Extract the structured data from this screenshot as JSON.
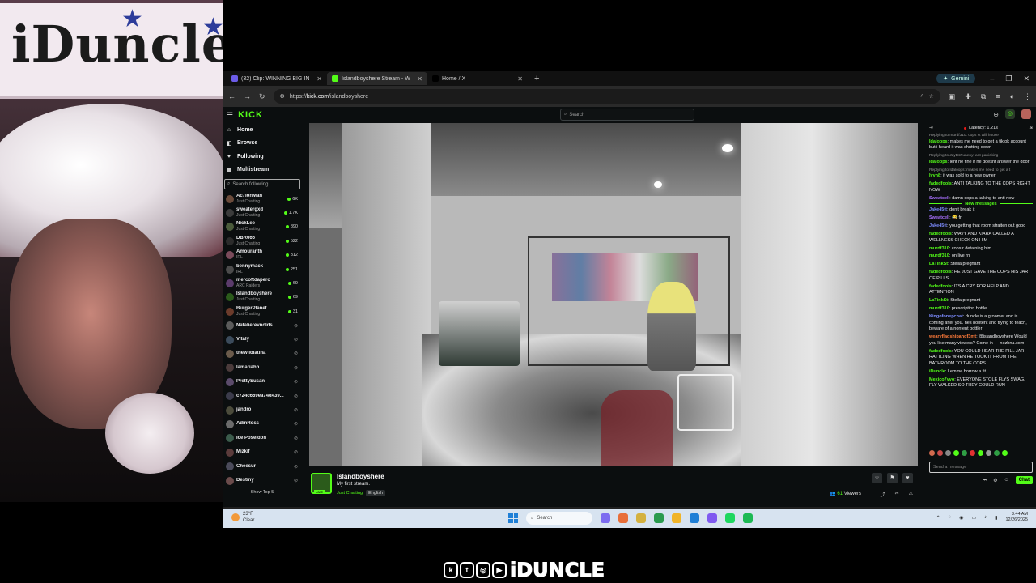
{
  "overlay": {
    "sign_text": "iDuncle",
    "brand_text": "iDUNCLE",
    "social_icons": [
      "kick-icon",
      "twitch-icon",
      "instagram-icon",
      "youtube-icon"
    ],
    "social_glyphs": [
      "k",
      "t",
      "◎",
      "▶"
    ]
  },
  "browser": {
    "tabs": [
      {
        "title": "(32) Clip: WINNING BIG IN",
        "active": false,
        "favicon": "#6c5ce7"
      },
      {
        "title": "Islandboyshere Stream - W",
        "active": true,
        "favicon": "#53fc18"
      },
      {
        "title": "Home / X",
        "active": false,
        "favicon": "#000000"
      }
    ],
    "gemini_label": "Gemini",
    "url_scheme": "https://",
    "url_host": "kick.com",
    "url_path": "/islandboyshere",
    "window_controls": [
      "–",
      "❐",
      "✕"
    ]
  },
  "kick": {
    "logo": "KICK",
    "search_placeholder": "Search",
    "nav": [
      {
        "label": "Home",
        "icon": "⌂"
      },
      {
        "label": "Browse",
        "icon": "◧"
      },
      {
        "label": "Following",
        "icon": "♥"
      },
      {
        "label": "Multistream",
        "icon": "▦"
      }
    ],
    "follow_search_placeholder": "Search following...",
    "channels": [
      {
        "name": "Ac7ionMan",
        "category": "Just Chatting",
        "viewers": "6K",
        "live": true
      },
      {
        "name": "sweatergxd",
        "category": "Just Chatting",
        "viewers": "1.7K",
        "live": true
      },
      {
        "name": "NickLee",
        "category": "Just Chatting",
        "viewers": "890",
        "live": true
      },
      {
        "name": "DBR666",
        "category": "Just Chatting",
        "viewers": "522",
        "live": true
      },
      {
        "name": "Amouranth",
        "category": "IRL",
        "viewers": "312",
        "live": true
      },
      {
        "name": "bennymack",
        "category": "IRL",
        "viewers": "251",
        "live": true
      },
      {
        "name": "mercoftdaperc",
        "category": "ARC Raiders",
        "viewers": "69",
        "live": true
      },
      {
        "name": "Islandboyshere",
        "category": "Just Chatting",
        "viewers": "69",
        "live": true
      },
      {
        "name": "BurgerPlanet",
        "category": "Just Chatting",
        "viewers": "31",
        "live": true
      },
      {
        "name": "Natalierevnolds",
        "category": "",
        "viewers": "",
        "live": false
      },
      {
        "name": "Vitaly",
        "category": "",
        "viewers": "",
        "live": false
      },
      {
        "name": "thewildlatina",
        "category": "",
        "viewers": "",
        "live": false
      },
      {
        "name": "lamariahh",
        "category": "",
        "viewers": "",
        "live": false
      },
      {
        "name": "PrettySusan",
        "category": "",
        "viewers": "",
        "live": false
      },
      {
        "name": "c724c669ea74d439...",
        "category": "",
        "viewers": "",
        "live": false
      },
      {
        "name": "jandro",
        "category": "",
        "viewers": "",
        "live": false
      },
      {
        "name": "AdinRoss",
        "category": "",
        "viewers": "",
        "live": false
      },
      {
        "name": "Ice Poseidon",
        "category": "",
        "viewers": "",
        "live": false
      },
      {
        "name": "Mizkif",
        "category": "",
        "viewers": "",
        "live": false
      },
      {
        "name": "Cheesur",
        "category": "",
        "viewers": "",
        "live": false
      },
      {
        "name": "Destiny",
        "category": "",
        "viewers": "",
        "live": false
      }
    ],
    "show_top": "Show Top 5",
    "stream": {
      "streamer": "Islandboyshere",
      "title": "My first stream.",
      "category": "Just Chatting",
      "language": "English",
      "viewers": "61",
      "viewers_label": "Viewers",
      "live_label": "LIVE"
    },
    "chat": {
      "latency": "Latency: 1.21s",
      "new_messages": "New messages",
      "messages": [
        {
          "reply": "Replying to murdf310: cops st will house",
          "user": "Idaloops",
          "color": "#53fc18",
          "text": "makes me need to get a tiktok account but i heard it was shutting down"
        },
        {
          "reply": "Replying to JayBsFuneny: ant panicking",
          "user": "Idaloops",
          "color": "#53fc18",
          "text": "lent he fine if he doesnt answer the door"
        },
        {
          "reply": "Replying to Idaloops: makes me need to get a t",
          "user": "Ivvh8",
          "color": "#53fc18",
          "text": "it was sold to a new owner"
        },
        {
          "reply": "",
          "user": "fadedfools",
          "color": "#53fc18",
          "text": "ANTI TALKING TO THE COPS RIGHT NOW"
        },
        {
          "reply": "",
          "user": "Sweatcell",
          "color": "#a970ff",
          "text": "damn cops a talking to anti now"
        },
        {
          "divider": true
        },
        {
          "reply": "",
          "user": "Jake45tt",
          "color": "#7d8cff",
          "text": "don't break it"
        },
        {
          "reply": "",
          "user": "Sweatcell",
          "color": "#a970ff",
          "text": "😂 fr"
        },
        {
          "reply": "",
          "user": "Jake45tt",
          "color": "#7d8cff",
          "text": "you getting that room straiten out good"
        },
        {
          "reply": "",
          "user": "fadedfools",
          "color": "#53fc18",
          "text": "WAVY AND KIARA CALLED A WELLNESS CHECK ON HIM"
        },
        {
          "reply": "",
          "user": "murdf310",
          "color": "#53fc18",
          "text": "cops r detaining him"
        },
        {
          "reply": "",
          "user": "murdf310",
          "color": "#53fc18",
          "text": "on live rn"
        },
        {
          "reply": "",
          "user": "LaTinkSt",
          "color": "#53fc18",
          "text": "Stella pregnant"
        },
        {
          "reply": "",
          "user": "fadedfools",
          "color": "#53fc18",
          "text": "HE JUST GAVE THE COPS HIS JAR OF PILLS"
        },
        {
          "reply": "",
          "user": "fadedfools",
          "color": "#53fc18",
          "text": "ITS A CRY FOR HELP AND ATTENTION"
        },
        {
          "reply": "",
          "user": "LaTinkSt",
          "color": "#53fc18",
          "text": "Stella pregnant"
        },
        {
          "reply": "",
          "user": "murdf310",
          "color": "#53fc18",
          "text": "prescription bottle"
        },
        {
          "reply": "",
          "user": "Kingofonepchat",
          "color": "#7d8cff",
          "text": "duncle is a groomer and is coming after you. hes nontent and trying to teach, beware of a nontent bottler"
        },
        {
          "reply": "",
          "user": "wearyflagshipahdf3mt",
          "color": "#ff7b3a",
          "text": "@islandboyshere Would you like many viewers? Come in — nezhna.com"
        },
        {
          "reply": "",
          "user": "fadedfools",
          "color": "#53fc18",
          "text": "YOU COULD HEAR THE PILL JAR RATTLING WHEN HE TOOK IT FROM THE BATHROOM TO THE COPS"
        },
        {
          "reply": "",
          "user": "iDuncle",
          "color": "#53fc18",
          "text": "Lemme borrow a fit."
        },
        {
          "reply": "",
          "user": "Mexico7vvo",
          "color": "#53fc18",
          "text": "EVERYONE STOLE FLYS SWAG, FLY WALKED SO THEY COULD RUN"
        }
      ],
      "input_placeholder": "Send a message",
      "send_label": "Chat",
      "emote_colors": [
        "#d26a4e",
        "#c94b4b",
        "#888888",
        "#53fc18",
        "#2f9e44",
        "#e03131",
        "#53fc18",
        "#999999",
        "#2f9e44",
        "#53fc18"
      ]
    }
  },
  "taskbar": {
    "temp": "23°F",
    "condition": "Clear",
    "search_label": "Search",
    "time": "3:44 AM",
    "date": "12/26/2025",
    "apps": [
      "#7c6cf0",
      "#e86f3a",
      "#d4b13f",
      "#2b9b4f",
      "#f0b429",
      "#1f7fd6",
      "#7f5af0",
      "#1ed760",
      "#1db954"
    ]
  }
}
